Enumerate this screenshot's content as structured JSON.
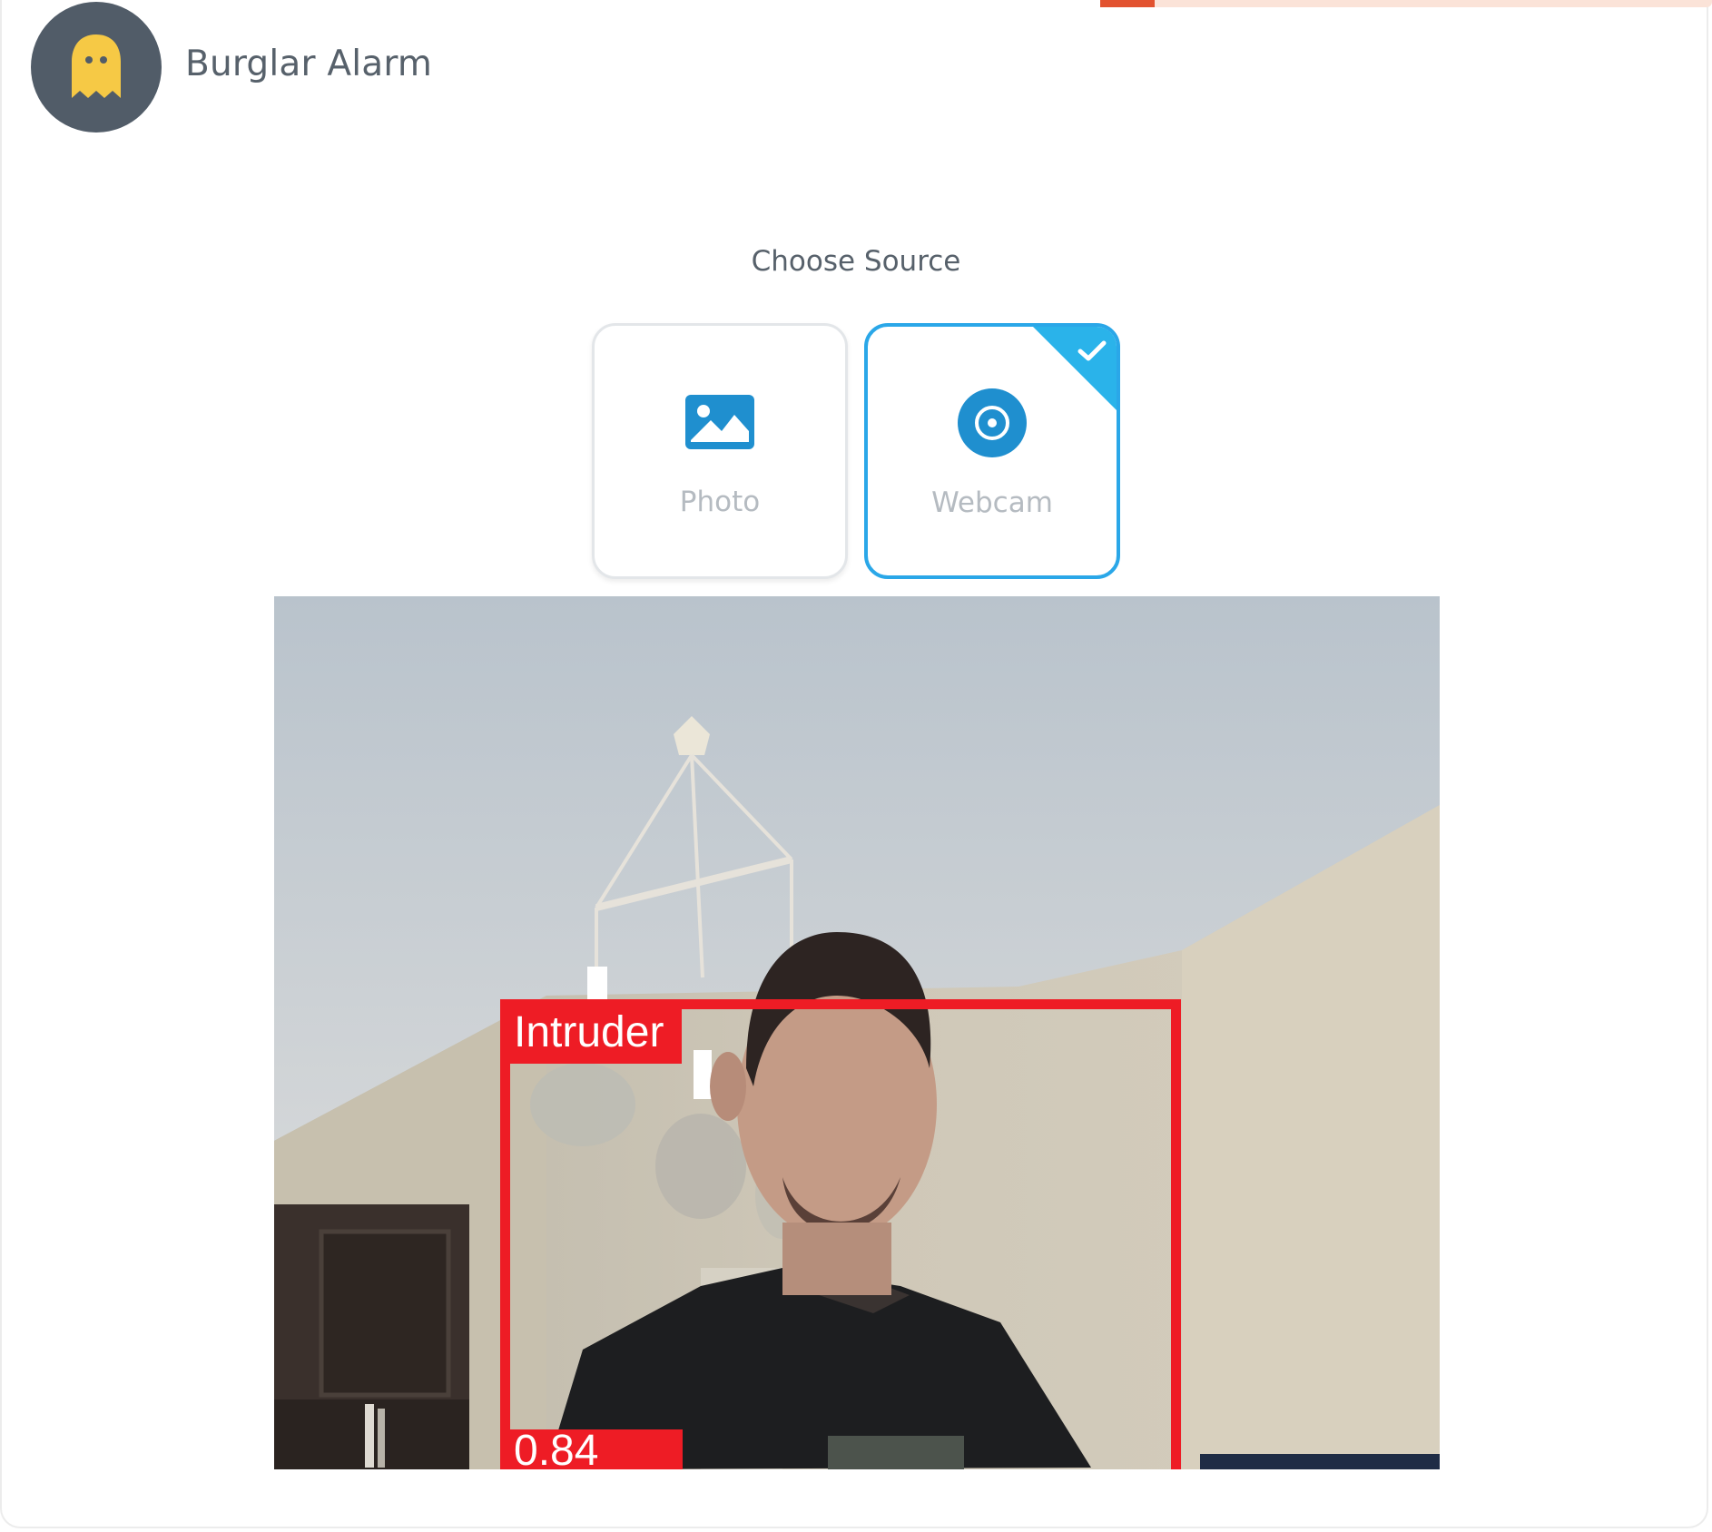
{
  "app": {
    "title": "Burglar Alarm",
    "avatar_icon": "ghost-icon",
    "avatar_bg": "#515c68",
    "avatar_icon_color": "#f6c945"
  },
  "source": {
    "heading": "Choose Source",
    "options": [
      {
        "label": "Photo",
        "icon": "image-icon",
        "selected": false
      },
      {
        "label": "Webcam",
        "icon": "webcam-icon",
        "selected": true
      }
    ],
    "accent_color": "#2aa7e8"
  },
  "detection": {
    "label": "Intruder",
    "score": "0.84",
    "box_color": "#ee1c25"
  }
}
